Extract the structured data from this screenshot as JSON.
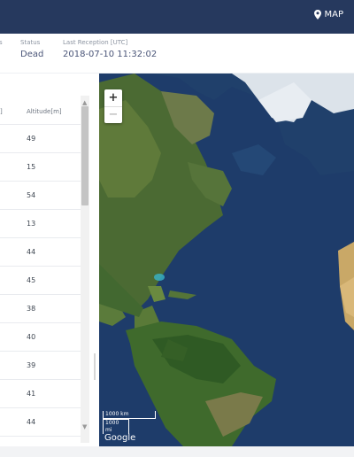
{
  "nav": {
    "map_label": "MAP",
    "map_icon": "map-pin-icon"
  },
  "info": {
    "partial_label": "s",
    "status_label": "Status",
    "status_value": "Dead",
    "reception_label": "Last Reception [UTC]",
    "reception_value": "2018-07-10 11:32:02"
  },
  "table": {
    "col_left_partial": "]",
    "altitude_header": "Altitude[m]",
    "altitudes": [
      "49",
      "15",
      "54",
      "13",
      "44",
      "45",
      "38",
      "40",
      "39",
      "41",
      "44"
    ]
  },
  "map": {
    "zoom_in": "+",
    "zoom_out": "−",
    "scale_km": "1000 km",
    "scale_mi": "1000 mi",
    "attribution": "Google"
  },
  "colors": {
    "header_bg": "#26395e",
    "status_text": "#4a5578",
    "ocean": "#1d3a66"
  }
}
